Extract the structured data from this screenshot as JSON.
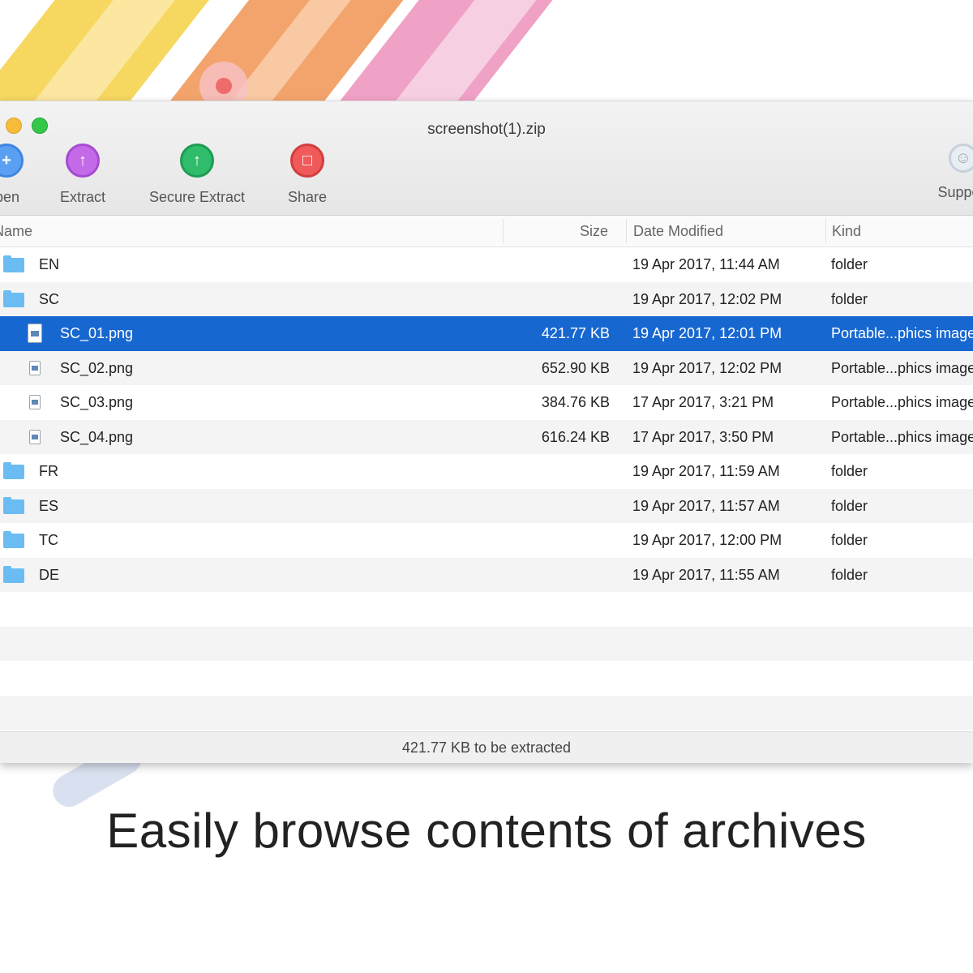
{
  "window": {
    "title": "screenshot(1).zip"
  },
  "toolbar": {
    "open_label": "Open",
    "extract_label": "Extract",
    "secure_extract_label": "Secure Extract",
    "share_label": "Share",
    "support_label": "Support"
  },
  "table": {
    "headers": {
      "name": "Name",
      "size": "Size",
      "date": "Date Modified",
      "kind": "Kind"
    },
    "rows": [
      {
        "name": "EN",
        "size": "",
        "date": "19 Apr 2017, 11:44 AM",
        "kind": "folder"
      },
      {
        "name": "SC",
        "size": "",
        "date": "19 Apr 2017, 12:02 PM",
        "kind": "folder"
      },
      {
        "name": "SC_01.png",
        "size": "421.77 KB",
        "date": "19 Apr 2017, 12:01 PM",
        "kind": "Portable...phics image"
      },
      {
        "name": "SC_02.png",
        "size": "652.90 KB",
        "date": "19 Apr 2017, 12:02 PM",
        "kind": "Portable...phics image"
      },
      {
        "name": "SC_03.png",
        "size": "384.76 KB",
        "date": "17 Apr 2017, 3:21 PM",
        "kind": "Portable...phics image"
      },
      {
        "name": "SC_04.png",
        "size": "616.24 KB",
        "date": "17 Apr 2017, 3:50 PM",
        "kind": "Portable...phics image"
      },
      {
        "name": "FR",
        "size": "",
        "date": "19 Apr 2017, 11:59 AM",
        "kind": "folder"
      },
      {
        "name": "ES",
        "size": "",
        "date": "19 Apr 2017, 11:57 AM",
        "kind": "folder"
      },
      {
        "name": "TC",
        "size": "",
        "date": "19 Apr 2017, 12:00 PM",
        "kind": "folder"
      },
      {
        "name": "DE",
        "size": "",
        "date": "19 Apr 2017, 11:55 AM",
        "kind": "folder"
      }
    ]
  },
  "status": {
    "text": "421.77 KB to be extracted"
  },
  "caption": "Easily browse contents of archives",
  "colors": {
    "selection": "#1767d0",
    "folder": "#6bbcf2",
    "extract_icon": "#c46ae8",
    "secure_icon": "#2fbd6c",
    "share_icon": "#f05a5a"
  }
}
